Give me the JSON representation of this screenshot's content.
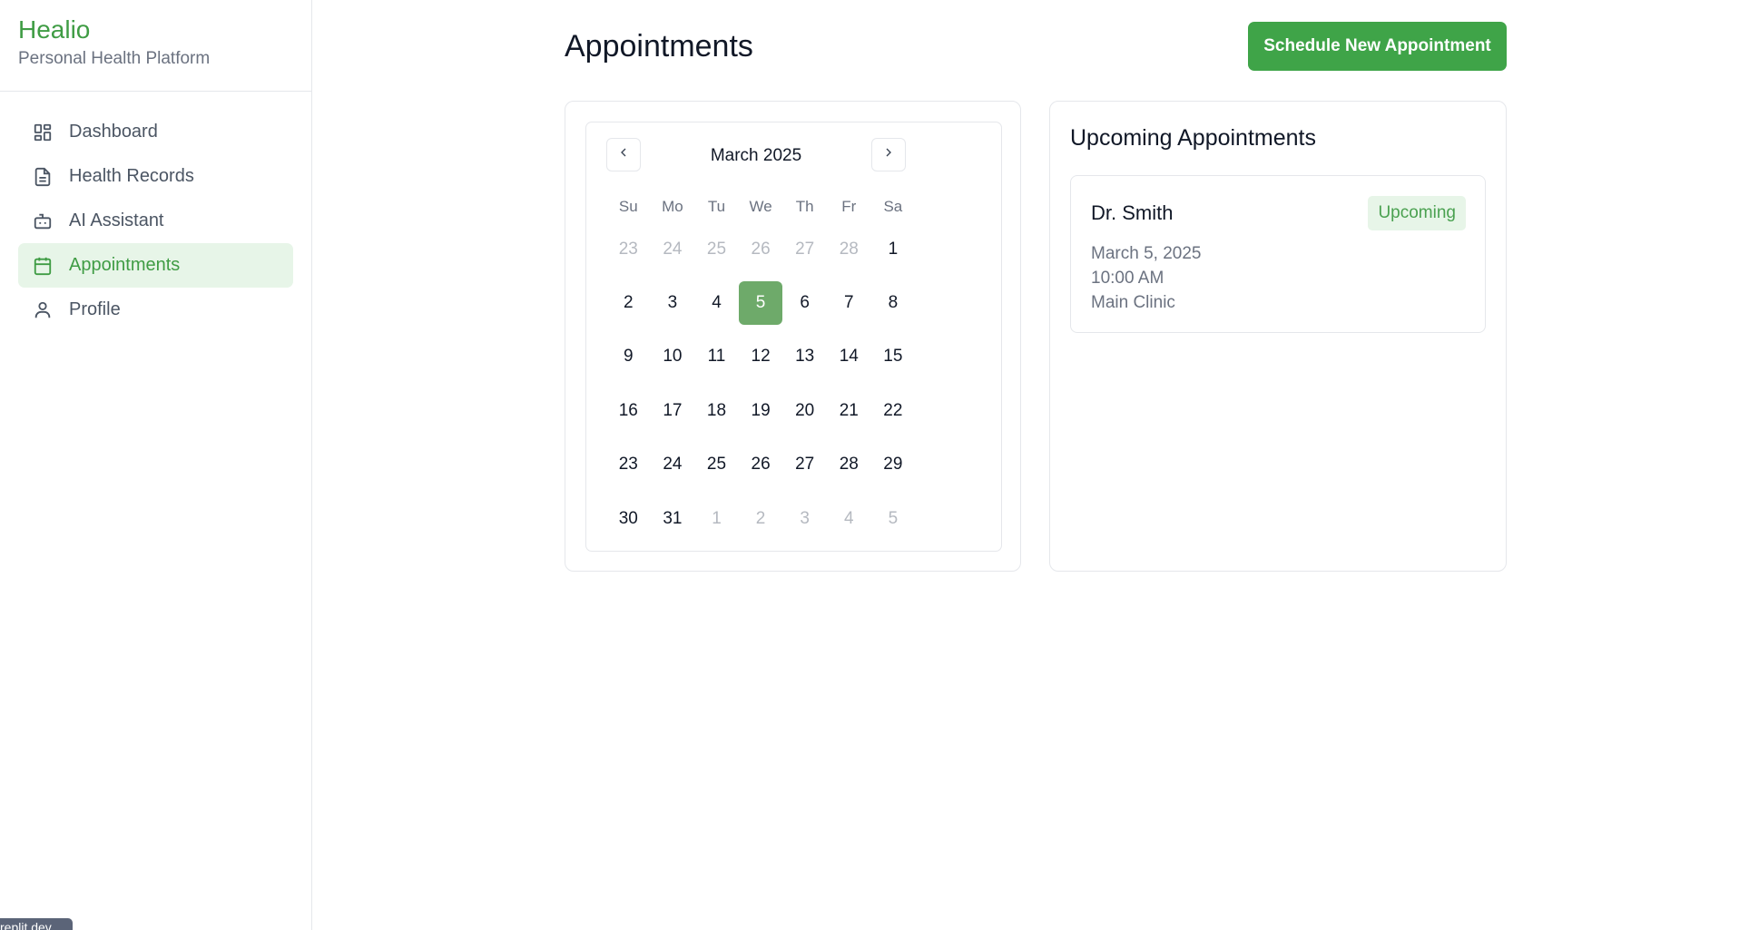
{
  "brand": {
    "name": "Healio",
    "tagline": "Personal Health Platform",
    "color": "#3f9c44"
  },
  "sidebar": {
    "items": [
      {
        "label": "Dashboard",
        "icon": "layout-grid-icon",
        "active": false
      },
      {
        "label": "Health Records",
        "icon": "file-text-icon",
        "active": false
      },
      {
        "label": "AI Assistant",
        "icon": "bot-icon",
        "active": false
      },
      {
        "label": "Appointments",
        "icon": "calendar-icon",
        "active": true
      },
      {
        "label": "Profile",
        "icon": "user-icon",
        "active": false
      }
    ]
  },
  "header": {
    "title": "Appointments",
    "schedule_button": "Schedule New Appointment"
  },
  "calendar": {
    "month_label": "March 2025",
    "weekdays": [
      "Su",
      "Mo",
      "Tu",
      "We",
      "Th",
      "Fr",
      "Sa"
    ],
    "weeks": [
      [
        {
          "d": "23",
          "m": true
        },
        {
          "d": "24",
          "m": true
        },
        {
          "d": "25",
          "m": true
        },
        {
          "d": "26",
          "m": true
        },
        {
          "d": "27",
          "m": true
        },
        {
          "d": "28",
          "m": true
        },
        {
          "d": "1"
        }
      ],
      [
        {
          "d": "2"
        },
        {
          "d": "3"
        },
        {
          "d": "4"
        },
        {
          "d": "5",
          "sel": true
        },
        {
          "d": "6"
        },
        {
          "d": "7"
        },
        {
          "d": "8"
        }
      ],
      [
        {
          "d": "9"
        },
        {
          "d": "10"
        },
        {
          "d": "11"
        },
        {
          "d": "12"
        },
        {
          "d": "13"
        },
        {
          "d": "14"
        },
        {
          "d": "15"
        }
      ],
      [
        {
          "d": "16"
        },
        {
          "d": "17"
        },
        {
          "d": "18"
        },
        {
          "d": "19"
        },
        {
          "d": "20"
        },
        {
          "d": "21"
        },
        {
          "d": "22"
        }
      ],
      [
        {
          "d": "23"
        },
        {
          "d": "24"
        },
        {
          "d": "25"
        },
        {
          "d": "26"
        },
        {
          "d": "27"
        },
        {
          "d": "28"
        },
        {
          "d": "29"
        }
      ],
      [
        {
          "d": "30"
        },
        {
          "d": "31"
        },
        {
          "d": "1",
          "m": true
        },
        {
          "d": "2",
          "m": true
        },
        {
          "d": "3",
          "m": true
        },
        {
          "d": "4",
          "m": true
        },
        {
          "d": "5",
          "m": true
        }
      ]
    ],
    "selected_color": "#6eaa6a"
  },
  "upcoming": {
    "title": "Upcoming Appointments",
    "appointments": [
      {
        "doctor": "Dr. Smith",
        "status": "Upcoming",
        "date": "March 5, 2025",
        "time": "10:00 AM",
        "location": "Main Clinic"
      }
    ]
  },
  "env_badge": "replit.dev"
}
